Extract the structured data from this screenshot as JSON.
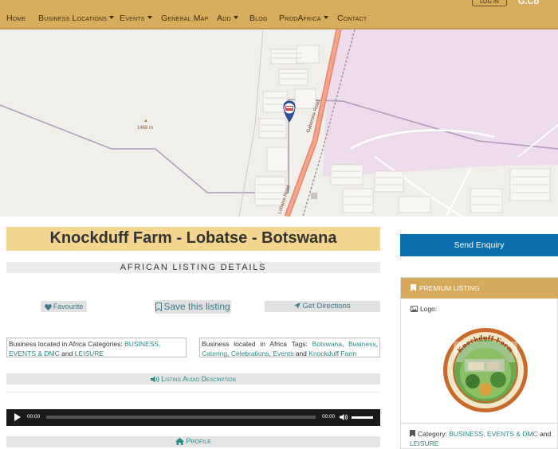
{
  "nav": {
    "items": [
      {
        "label": "Home",
        "dropdown": false
      },
      {
        "label": "Business Locations",
        "dropdown": true
      },
      {
        "label": "Events",
        "dropdown": true
      },
      {
        "label": "General Map",
        "dropdown": false
      },
      {
        "label": "Add",
        "dropdown": true
      },
      {
        "label": "Blog",
        "dropdown": false
      },
      {
        "label": "ProdAfrica",
        "dropdown": true
      },
      {
        "label": "Contact",
        "dropdown": false
      }
    ],
    "login_label": "LOG IN",
    "top_right_text": "G.Co"
  },
  "map": {
    "elevation_label": "1466 m",
    "road_label": "Gaborone Road",
    "road_label_2": "Lobatse Road"
  },
  "listing": {
    "title": "Knockduff Farm - Lobatse - Botswana",
    "section_header": "AFRICAN LISTING DETAILS",
    "favourite_label": "Favourite",
    "save_label": "Save this listing",
    "directions_label": "Get Directions",
    "categories_prefix": "Business located in Africa Categories:",
    "categories": [
      "BUSINESS, EVENTS & DMC",
      "LEISURE"
    ],
    "tags_prefix": "Business located in Africa Tags:",
    "tags": [
      "Botswana",
      "Business",
      "Catering",
      "Celebrations",
      "Events",
      "Knockduff Farm"
    ],
    "and_word": "and",
    "audio_label": "Listing Audio Description",
    "player": {
      "current_time": "00:00",
      "duration": "00:00",
      "progress": 0
    },
    "profile_label": "Profile"
  },
  "sidebar": {
    "send_enquiry_label": "Send Enquiry",
    "premium_label": "PREMIUM LISTING",
    "logo_label": "Logo:",
    "logo_text": "Knockduff Farm",
    "category_prefix": "Category:",
    "category_link_1": "BUSINESS, EVENTS & DMC",
    "category_and": "and",
    "category_link_2": "LEISURE"
  },
  "colors": {
    "nav_bg": "#d7ad5d",
    "title_bg": "#f2d58e",
    "link": "#2a8a86",
    "send_enquiry_bg": "#0c6fad",
    "premium_bg": "#d5aa5d"
  }
}
